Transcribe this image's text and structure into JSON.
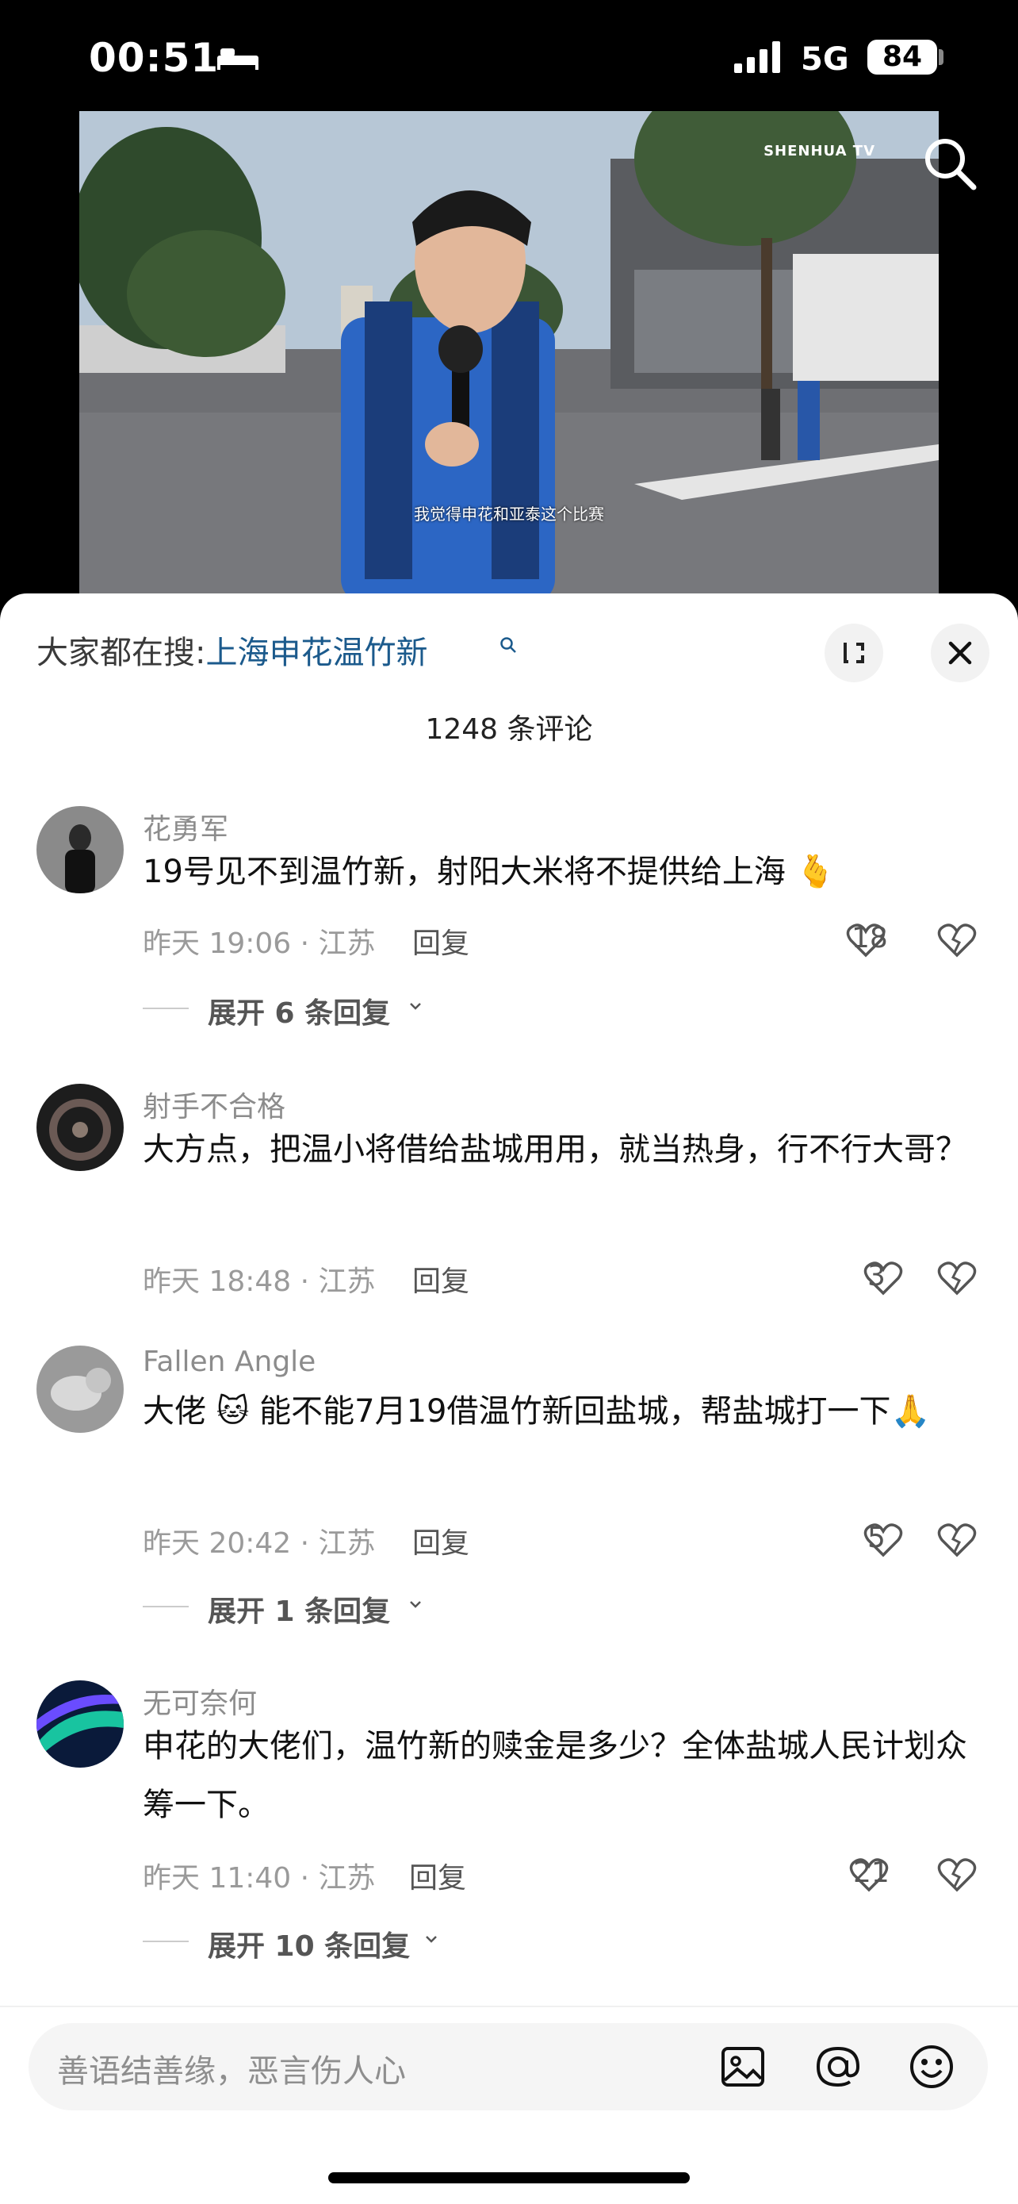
{
  "status_bar": {
    "time": "00:51",
    "network": "5G",
    "battery": "84"
  },
  "video": {
    "subtitle": "我觉得申花和亚泰这个比赛",
    "brand": "SHENHUA TV"
  },
  "search_suggest": {
    "prefix": "大家都在搜:",
    "query": "上海申花温竹新"
  },
  "comments_count": "1248 条评论",
  "comments": [
    {
      "name": "花勇军",
      "text": "19号见不到温竹新，射阳大米将不提供给上海 🫰",
      "time": "昨天 19:06 · 江苏",
      "reply": "回复",
      "likes": "18",
      "expand": "展开 6 条回复"
    },
    {
      "name": "射手不合格",
      "text": "大方点，把温小将借给盐城用用，就当热身，行不行大哥？",
      "time": "昨天 18:48 · 江苏",
      "reply": "回复",
      "likes": "3"
    },
    {
      "name": "Fallen Angle",
      "text": "大佬 🐱 能不能7月19借温竹新回盐城，帮盐城打一下🙏",
      "time": "昨天 20:42 · 江苏",
      "reply": "回复",
      "likes": "5",
      "expand": "展开 1 条回复"
    },
    {
      "name": "无可奈何",
      "text": "申花的大佬们，温竹新的赎金是多少？全体盐城人民计划众筹一下。",
      "time": "昨天 11:40 · 江苏",
      "reply": "回复",
      "likes": "21",
      "expand": "展开 10 条回复"
    }
  ],
  "input": {
    "placeholder": "善语结善缘，恶言伤人心"
  },
  "icons": [
    "bed-icon",
    "signal-icon",
    "battery-icon",
    "search-icon",
    "expand-icon",
    "close-icon",
    "heart-icon",
    "broken-heart-icon",
    "chevron-down-icon",
    "image-icon",
    "at-icon",
    "emoji-icon"
  ]
}
